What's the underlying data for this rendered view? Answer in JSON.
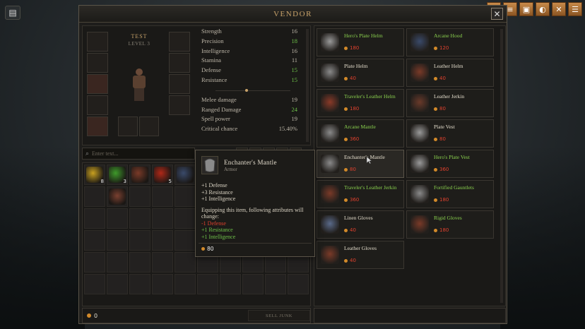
{
  "window": {
    "title": "VENDOR",
    "close_label": "✕"
  },
  "top_bar": [
    "▲",
    "≡",
    "▣",
    "◐",
    "✕",
    "☰"
  ],
  "character": {
    "name": "TEST",
    "level": "LEVEL 3",
    "stats": [
      {
        "label": "Strength",
        "value": "16",
        "changed": false
      },
      {
        "label": "Precision",
        "value": "18",
        "changed": true
      },
      {
        "label": "Intelligence",
        "value": "16",
        "changed": false
      },
      {
        "label": "Stamina",
        "value": "11",
        "changed": false
      },
      {
        "label": "Defense",
        "value": "15",
        "changed": true
      },
      {
        "label": "Resistance",
        "value": "15",
        "changed": true
      }
    ],
    "combat": [
      {
        "label": "Melee damage",
        "value": "19",
        "changed": false
      },
      {
        "label": "Ranged Damage",
        "value": "24",
        "changed": true
      },
      {
        "label": "Spell power",
        "value": "19",
        "changed": false
      },
      {
        "label": "Critical chance",
        "value": "15.40%",
        "changed": false
      }
    ]
  },
  "search": {
    "placeholder": "Enter text..."
  },
  "inventory": {
    "items": [
      {
        "name": "claw-item",
        "count": "8",
        "color": "#c8a020"
      },
      {
        "name": "herb-item",
        "count": "3",
        "color": "#3e9a2a"
      },
      {
        "name": "club-item",
        "count": "",
        "color": "#7a3a28"
      },
      {
        "name": "red-wisp-item",
        "count": "5",
        "color": "#b02818"
      },
      {
        "name": "orb-item",
        "count": "",
        "color": "#3a4a6a"
      }
    ],
    "second_row_item": {
      "name": "armor-item",
      "color": "#7a4030"
    }
  },
  "footer": {
    "gold": "0",
    "sell_junk": "SELL JUNK"
  },
  "vendor_items": [
    {
      "name": "Hero's Plate Helm",
      "price": "180",
      "green": true,
      "icon": "plate-helm-icon",
      "color": "#9a9a9a"
    },
    {
      "name": "Arcane Hood",
      "price": "120",
      "green": true,
      "icon": "hood-icon",
      "color": "#3a4a6a"
    },
    {
      "name": "Plate Helm",
      "price": "40",
      "green": false,
      "icon": "plate-helm-icon",
      "color": "#8a8a8a"
    },
    {
      "name": "Leather Helm",
      "price": "40",
      "green": false,
      "icon": "leather-helm-icon",
      "color": "#7a3a28"
    },
    {
      "name": "Traveler's Leather Helm",
      "price": "180",
      "green": true,
      "icon": "leather-helm-icon",
      "color": "#8a3a28"
    },
    {
      "name": "Leather Jerkin",
      "price": "80",
      "green": false,
      "icon": "jerkin-icon",
      "color": "#6a3a2a"
    },
    {
      "name": "Arcane Mantle",
      "price": "360",
      "green": true,
      "icon": "mantle-icon",
      "color": "#8a8a8a"
    },
    {
      "name": "Plate Vest",
      "price": "80",
      "green": false,
      "icon": "vest-icon",
      "color": "#9a9a9a"
    },
    {
      "name": "Enchanter's Mantle",
      "price": "80",
      "green": false,
      "icon": "mantle-icon",
      "color": "#8a8a8a"
    },
    {
      "name": "Hero's Plate Vest",
      "price": "360",
      "green": true,
      "icon": "vest-icon",
      "color": "#9a9a9a"
    },
    {
      "name": "Traveler's Leather Jerkin",
      "price": "360",
      "green": true,
      "icon": "jerkin-icon",
      "color": "#7a3a28"
    },
    {
      "name": "Fortified Gauntlets",
      "price": "180",
      "green": true,
      "icon": "gauntlets-icon",
      "color": "#8a8a8a"
    },
    {
      "name": "Linen Gloves",
      "price": "40",
      "green": false,
      "icon": "gloves-icon",
      "color": "#5a6a8a"
    },
    {
      "name": "Rigid Gloves",
      "price": "180",
      "green": true,
      "icon": "gloves-icon",
      "color": "#7a3a28"
    },
    {
      "name": "Leather Gloves",
      "price": "40",
      "green": false,
      "icon": "gloves-icon",
      "color": "#7a3a28"
    }
  ],
  "tooltip": {
    "name": "Enchanter's Mantle",
    "type": "Armor",
    "bonuses": [
      "+1 Defense",
      "+3 Resistance",
      "+1 Intelligence"
    ],
    "change_text": "Equipping this item, following attributes will change:",
    "changes": [
      {
        "text": "-1 Defense",
        "dir": "down"
      },
      {
        "text": "+1 Resistance",
        "dir": "up"
      },
      {
        "text": "+1 Intelligence",
        "dir": "up"
      }
    ],
    "price": "80"
  },
  "colors": {
    "accent": "#c9a36a",
    "positive": "#6fc34a",
    "negative": "#e0412e",
    "gold": "#d28a2a",
    "rare": "#8ad14e"
  }
}
